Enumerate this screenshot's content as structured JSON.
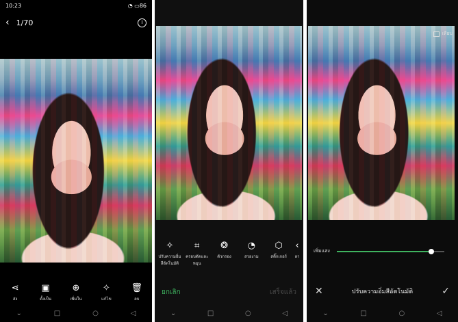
{
  "status": {
    "time": "10:23",
    "battery": "86"
  },
  "viewer": {
    "back_icon": "chevron-left-icon",
    "counter": "1/70",
    "info_icon": "info-icon",
    "actions": [
      {
        "icon": "share-icon",
        "glyph": "⋖",
        "label": "ส่ง"
      },
      {
        "icon": "set-as-icon",
        "glyph": "▣",
        "label": "ตั้งเป็น"
      },
      {
        "icon": "add-icon",
        "glyph": "⊕",
        "label": "เพิ่มใน"
      },
      {
        "icon": "magic-wand-icon",
        "glyph": "✧",
        "label": "แก้ไข"
      },
      {
        "icon": "trash-icon",
        "glyph": "🗑",
        "label": "ลบ"
      }
    ]
  },
  "editor": {
    "tools": [
      {
        "icon": "auto-enhance-icon",
        "glyph": "✧",
        "label": "ปรับความอิ่ม สีอัตโนมัติ"
      },
      {
        "icon": "crop-rotate-icon",
        "glyph": "⌗",
        "label": "ครอบตัดและ หมุน"
      },
      {
        "icon": "filter-icon",
        "glyph": "❂",
        "label": "ตัวกรอง"
      },
      {
        "icon": "beauty-icon",
        "glyph": "◔",
        "label": "สวยงาม"
      },
      {
        "icon": "sticker-icon",
        "glyph": "⬡",
        "label": "สติ๊กเกอร์"
      },
      {
        "icon": "more-icon",
        "glyph": "‹",
        "label": "ลา"
      }
    ],
    "cancel_label": "ยกเลิก",
    "done_label": "เสร็จแล้ว"
  },
  "adjust": {
    "compare_label": "เทียบ",
    "slider_label": "เพิ่มแสง",
    "slider_value": 0.88,
    "close_icon": "close-icon",
    "title": "ปรับความอิ่มสีอัตโนมัติ",
    "confirm_icon": "check-icon"
  },
  "nav": {
    "items": [
      {
        "icon": "chevron-down-icon",
        "glyph": "⌄"
      },
      {
        "icon": "square-icon",
        "glyph": "□"
      },
      {
        "icon": "circle-icon",
        "glyph": "○"
      },
      {
        "icon": "back-triangle-icon",
        "glyph": "◁"
      }
    ]
  },
  "colors": {
    "accent": "#3fb35f",
    "background": "#000000"
  }
}
